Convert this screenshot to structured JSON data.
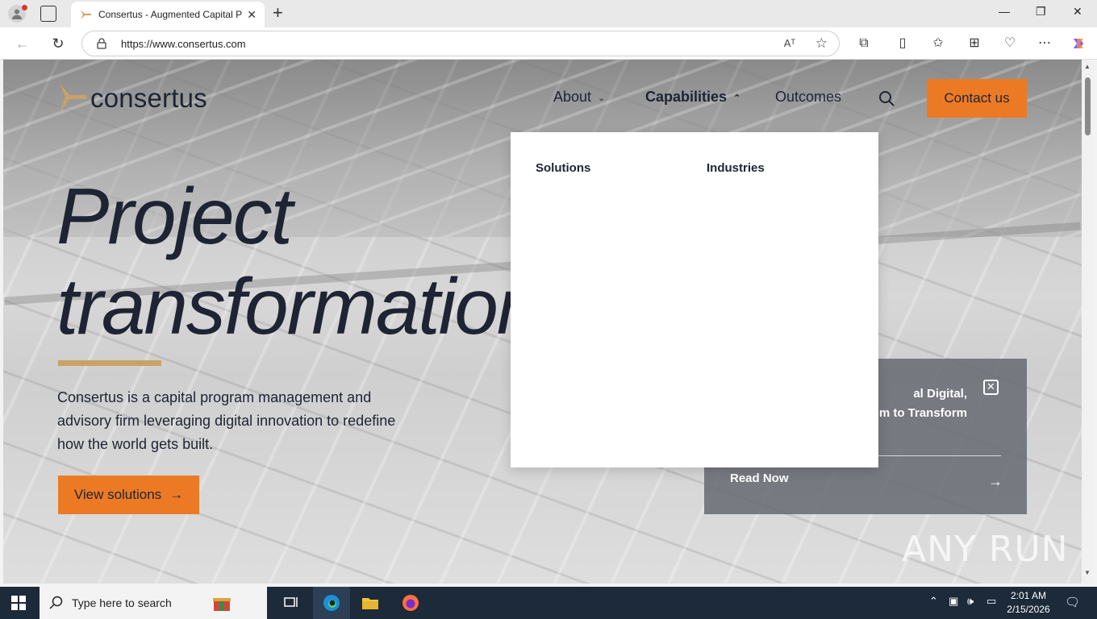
{
  "browser": {
    "tab_title": "Consertus - Augmented Capital P",
    "new_tab_label": "+",
    "url": "https://www.consertus.com",
    "read_aloud_label": "Aᵀ",
    "window_controls": {
      "minimize": "—",
      "restore": "❐",
      "close": "✕"
    }
  },
  "site": {
    "logo_text": "consertus",
    "nav": {
      "about": "About",
      "capabilities": "Capabilities",
      "outcomes": "Outcomes",
      "contact": "Contact us"
    },
    "dropdown": {
      "col1": "Solutions",
      "col2": "Industries"
    },
    "hero": {
      "line1": "Project",
      "line2": "transformation",
      "description": "Consertus is a capital program management and advisory firm leveraging digital innovation to redefine how the world gets built.",
      "cta": "View solutions"
    },
    "card": {
      "text_line1": "al Digital,",
      "text_line2": "m to Transform",
      "link": "Read Now"
    },
    "watermark": "ANY RUN"
  },
  "taskbar": {
    "search_placeholder": "Type here to search",
    "time": "2:01 AM",
    "date": "2/15/2026"
  },
  "colors": {
    "accent_orange": "#ec7a24",
    "gold_rule": "#c9a266",
    "text_dark": "#1e2433",
    "taskbar": "#1c2a3a"
  }
}
